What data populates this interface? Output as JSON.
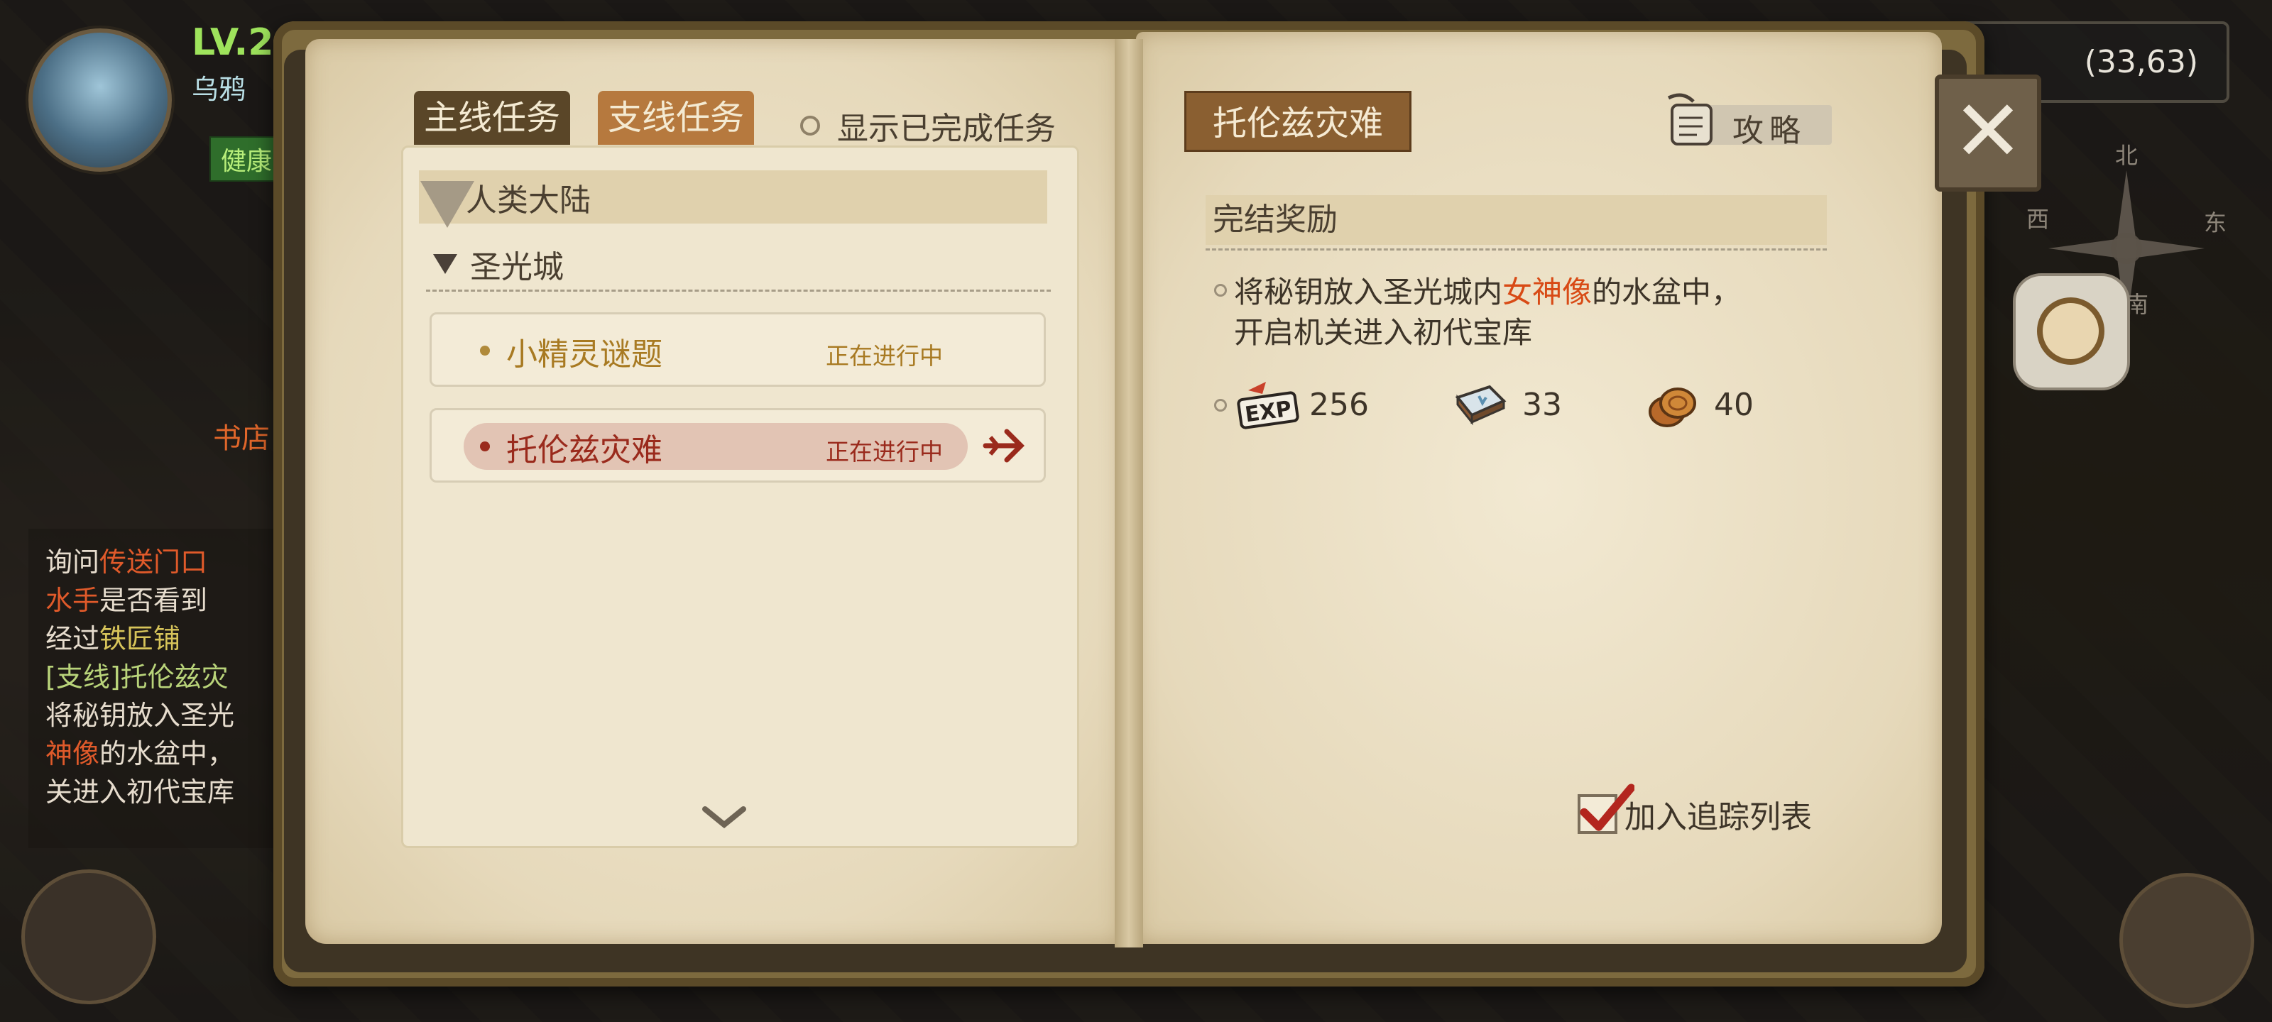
{
  "hud": {
    "level": "LV.2",
    "player_name": "乌鸦",
    "health_status": "健康",
    "coordinates": "(33,63)",
    "shop_label": "书店",
    "compass": {
      "north": "北",
      "west": "西",
      "east": "东",
      "south": "南"
    },
    "side_panel": {
      "line1_a": "询问",
      "line1_b": "传送门口",
      "line2_a": "水手",
      "line2_b": "是否看到",
      "line3_a": "经过",
      "line3_b": "铁匠铺",
      "line4": "[支线]托伦兹灾",
      "line5": "将秘钥放入圣光",
      "line6_a": "神像",
      "line6_b": "的水盆中，",
      "line7": "关进入初代宝库"
    }
  },
  "journal": {
    "tabs": {
      "main": "主线任务",
      "side": "支线任务"
    },
    "show_completed_label": "显示已完成任务",
    "region": "人类大陆",
    "city": "圣光城",
    "quests": [
      {
        "name": "小精灵谜题",
        "status": "正在进行中",
        "selected": false
      },
      {
        "name": "托伦兹灾难",
        "status": "正在进行中",
        "selected": true
      }
    ],
    "detail": {
      "title": "托伦兹灾难",
      "guide_label": "攻略",
      "reward_header": "完结奖励",
      "desc_part1": "将秘钥放入圣光城内",
      "desc_highlight": "女神像",
      "desc_part2": "的水盆中，",
      "desc_line2": "开启机关进入初代宝库",
      "rewards": [
        {
          "icon": "exp-icon",
          "value": "256"
        },
        {
          "icon": "book-item-icon",
          "value": "33"
        },
        {
          "icon": "coin-icon",
          "value": "40"
        }
      ],
      "track_label": "加入追踪列表",
      "tracked": true
    }
  },
  "colors": {
    "accent_side_tab": "#b6793e",
    "main_tab": "#5a4628",
    "selected_quest": "#9a2a1c",
    "quest_normal": "#a87a22",
    "highlight": "#d84a15"
  }
}
